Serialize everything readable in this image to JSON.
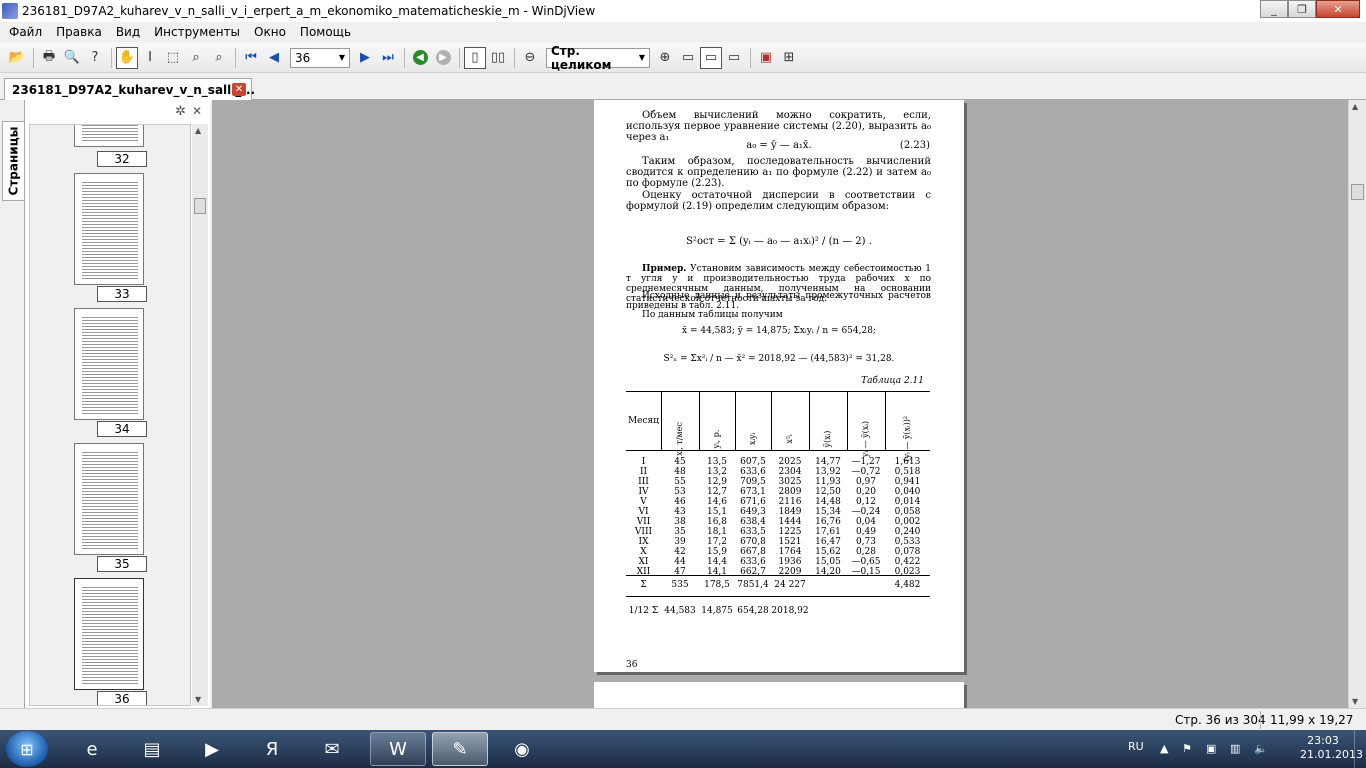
{
  "window": {
    "title": "236181_D97A2_kuharev_v_n_salli_v_i_erpert_a_m_ekonomiko_matematicheskie_m - WinDjView",
    "minimize": "_",
    "maximize": "❐",
    "close": "✕"
  },
  "menu": [
    "Файл",
    "Правка",
    "Вид",
    "Инструменты",
    "Окно",
    "Помощь"
  ],
  "toolbar": {
    "page_number": "36",
    "zoom_value": "Стр. целиком"
  },
  "tab": {
    "label": "236181_D97A2_kuharev_v_n_salli_...",
    "close": "✕"
  },
  "sidebar": {
    "tab_label": "Страницы",
    "thumbnails": [
      "32",
      "33",
      "34",
      "35",
      "36"
    ]
  },
  "page": {
    "p1": "Объем вычислений можно сократить, если, используя первое уравнение системы (2.20), выразить a₀ через a₁",
    "eq1": "a₀ = ȳ — a₁x̄.",
    "eq1_num": "(2.23)",
    "p2": "Таким образом, последовательность вычислений сводится к определению a₁ по формуле (2.22) и затем a₀ по формуле (2.23).",
    "p3": "Оценку остаточной дисперсии в соответствии с формулой (2.19) определим следующим образом:",
    "eq2": "S²ост = Σ (yᵢ — a₀ — a₁xᵢ)² / (n — 2) .",
    "p4_bold": "Пример.",
    "p4": " Установим зависимость между себестоимостью 1 т угля y и производительностью труда рабочих x по среднемесячным данным, полученным на основании статистической отчетности шахты за год.",
    "p5": "Исходные данные и результаты промежуточных расчетов приведены в табл. 2.11.",
    "p6": "По данным таблицы получим",
    "eq3": "x̄ = 44,583;  ȳ = 14,875;  Σxᵢyᵢ / n = 654,28;",
    "eq4": "S²ₓ = Σx²ᵢ / n — x̄² = 2018,92 — (44,583)² = 31,28.",
    "table_title": "Таблица 2.11",
    "headers": [
      "Месяц",
      "xᵢ, т/мес",
      "yᵢ, р.",
      "xᵢyᵢ",
      "x²ᵢ",
      "ȳ(xᵢ)",
      "yᵢ — ȳ(xᵢ)",
      "(yᵢ — ȳ(xᵢ))²"
    ],
    "rows": [
      [
        "I",
        "45",
        "13,5",
        "607,5",
        "2025",
        "14,77",
        "—1,27",
        "1,613"
      ],
      [
        "II",
        "48",
        "13,2",
        "633,6",
        "2304",
        "13,92",
        "—0,72",
        "0,518"
      ],
      [
        "III",
        "55",
        "12,9",
        "709,5",
        "3025",
        "11,93",
        "0,97",
        "0,941"
      ],
      [
        "IV",
        "53",
        "12,7",
        "673,1",
        "2809",
        "12,50",
        "0,20",
        "0,040"
      ],
      [
        "V",
        "46",
        "14,6",
        "671,6",
        "2116",
        "14,48",
        "0,12",
        "0,014"
      ],
      [
        "VI",
        "43",
        "15,1",
        "649,3",
        "1849",
        "15,34",
        "—0,24",
        "0,058"
      ],
      [
        "VII",
        "38",
        "16,8",
        "638,4",
        "1444",
        "16,76",
        "0,04",
        "0,002"
      ],
      [
        "VIII",
        "35",
        "18,1",
        "633,5",
        "1225",
        "17,61",
        "0,49",
        "0,240"
      ],
      [
        "IX",
        "39",
        "17,2",
        "670,8",
        "1521",
        "16,47",
        "0,73",
        "0,533"
      ],
      [
        "X",
        "42",
        "15,9",
        "667,8",
        "1764",
        "15,62",
        "0,28",
        "0,078"
      ],
      [
        "XI",
        "44",
        "14,4",
        "633,6",
        "1936",
        "15,05",
        "—0,65",
        "0,422"
      ],
      [
        "XII",
        "47",
        "14,1",
        "662,7",
        "2209",
        "14,20",
        "—0,15",
        "0,023"
      ]
    ],
    "sum_row": [
      "Σ",
      "535",
      "178,5",
      "7851,4",
      "24 227",
      "",
      "",
      "4,482"
    ],
    "avg_row": [
      "1/12 Σ",
      "44,583",
      "14,875",
      "654,28",
      "2018,92",
      "",
      "",
      ""
    ],
    "page_number": "36"
  },
  "status": {
    "page": "Стр. 36 из 304",
    "size": "11,99 x 19,27 см"
  },
  "taskbar": {
    "lang": "RU",
    "time": "23:03",
    "date": "21.01.2013"
  }
}
